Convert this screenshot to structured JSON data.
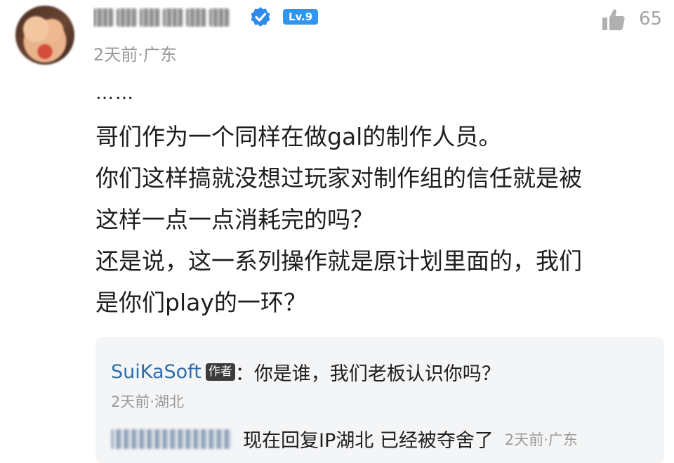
{
  "comment": {
    "level_badge": "Lv.9",
    "like_count": "65",
    "meta": "2天前·广东",
    "ellipsis": "……",
    "lines": [
      "哥们作为一个同样在做gal的制作人员。",
      "你们这样搞就没想过玩家对制作组的信任就是被",
      "这样一点一点消耗完的吗？",
      "还是说，这一系列操作就是原计划里面的，我们",
      "是你们play的一环？"
    ]
  },
  "replies": [
    {
      "author": "SuiKaSoft",
      "author_badge": "作者",
      "separator": "：",
      "text": "你是谁，我们老板认识你吗？",
      "meta": "2天前·湖北"
    },
    {
      "text": "现在回复IP湖北 已经被夺舍了",
      "meta": "2天前·广东"
    }
  ],
  "colors": {
    "level_badge": "#2f95ee",
    "verified": "#2f8bea",
    "reply_author": "#2d6da8",
    "meta": "#999999",
    "reply_box": "#f4f5f7"
  },
  "icons": {
    "verified": "verified-check-icon",
    "like": "thumbs-up-icon"
  }
}
